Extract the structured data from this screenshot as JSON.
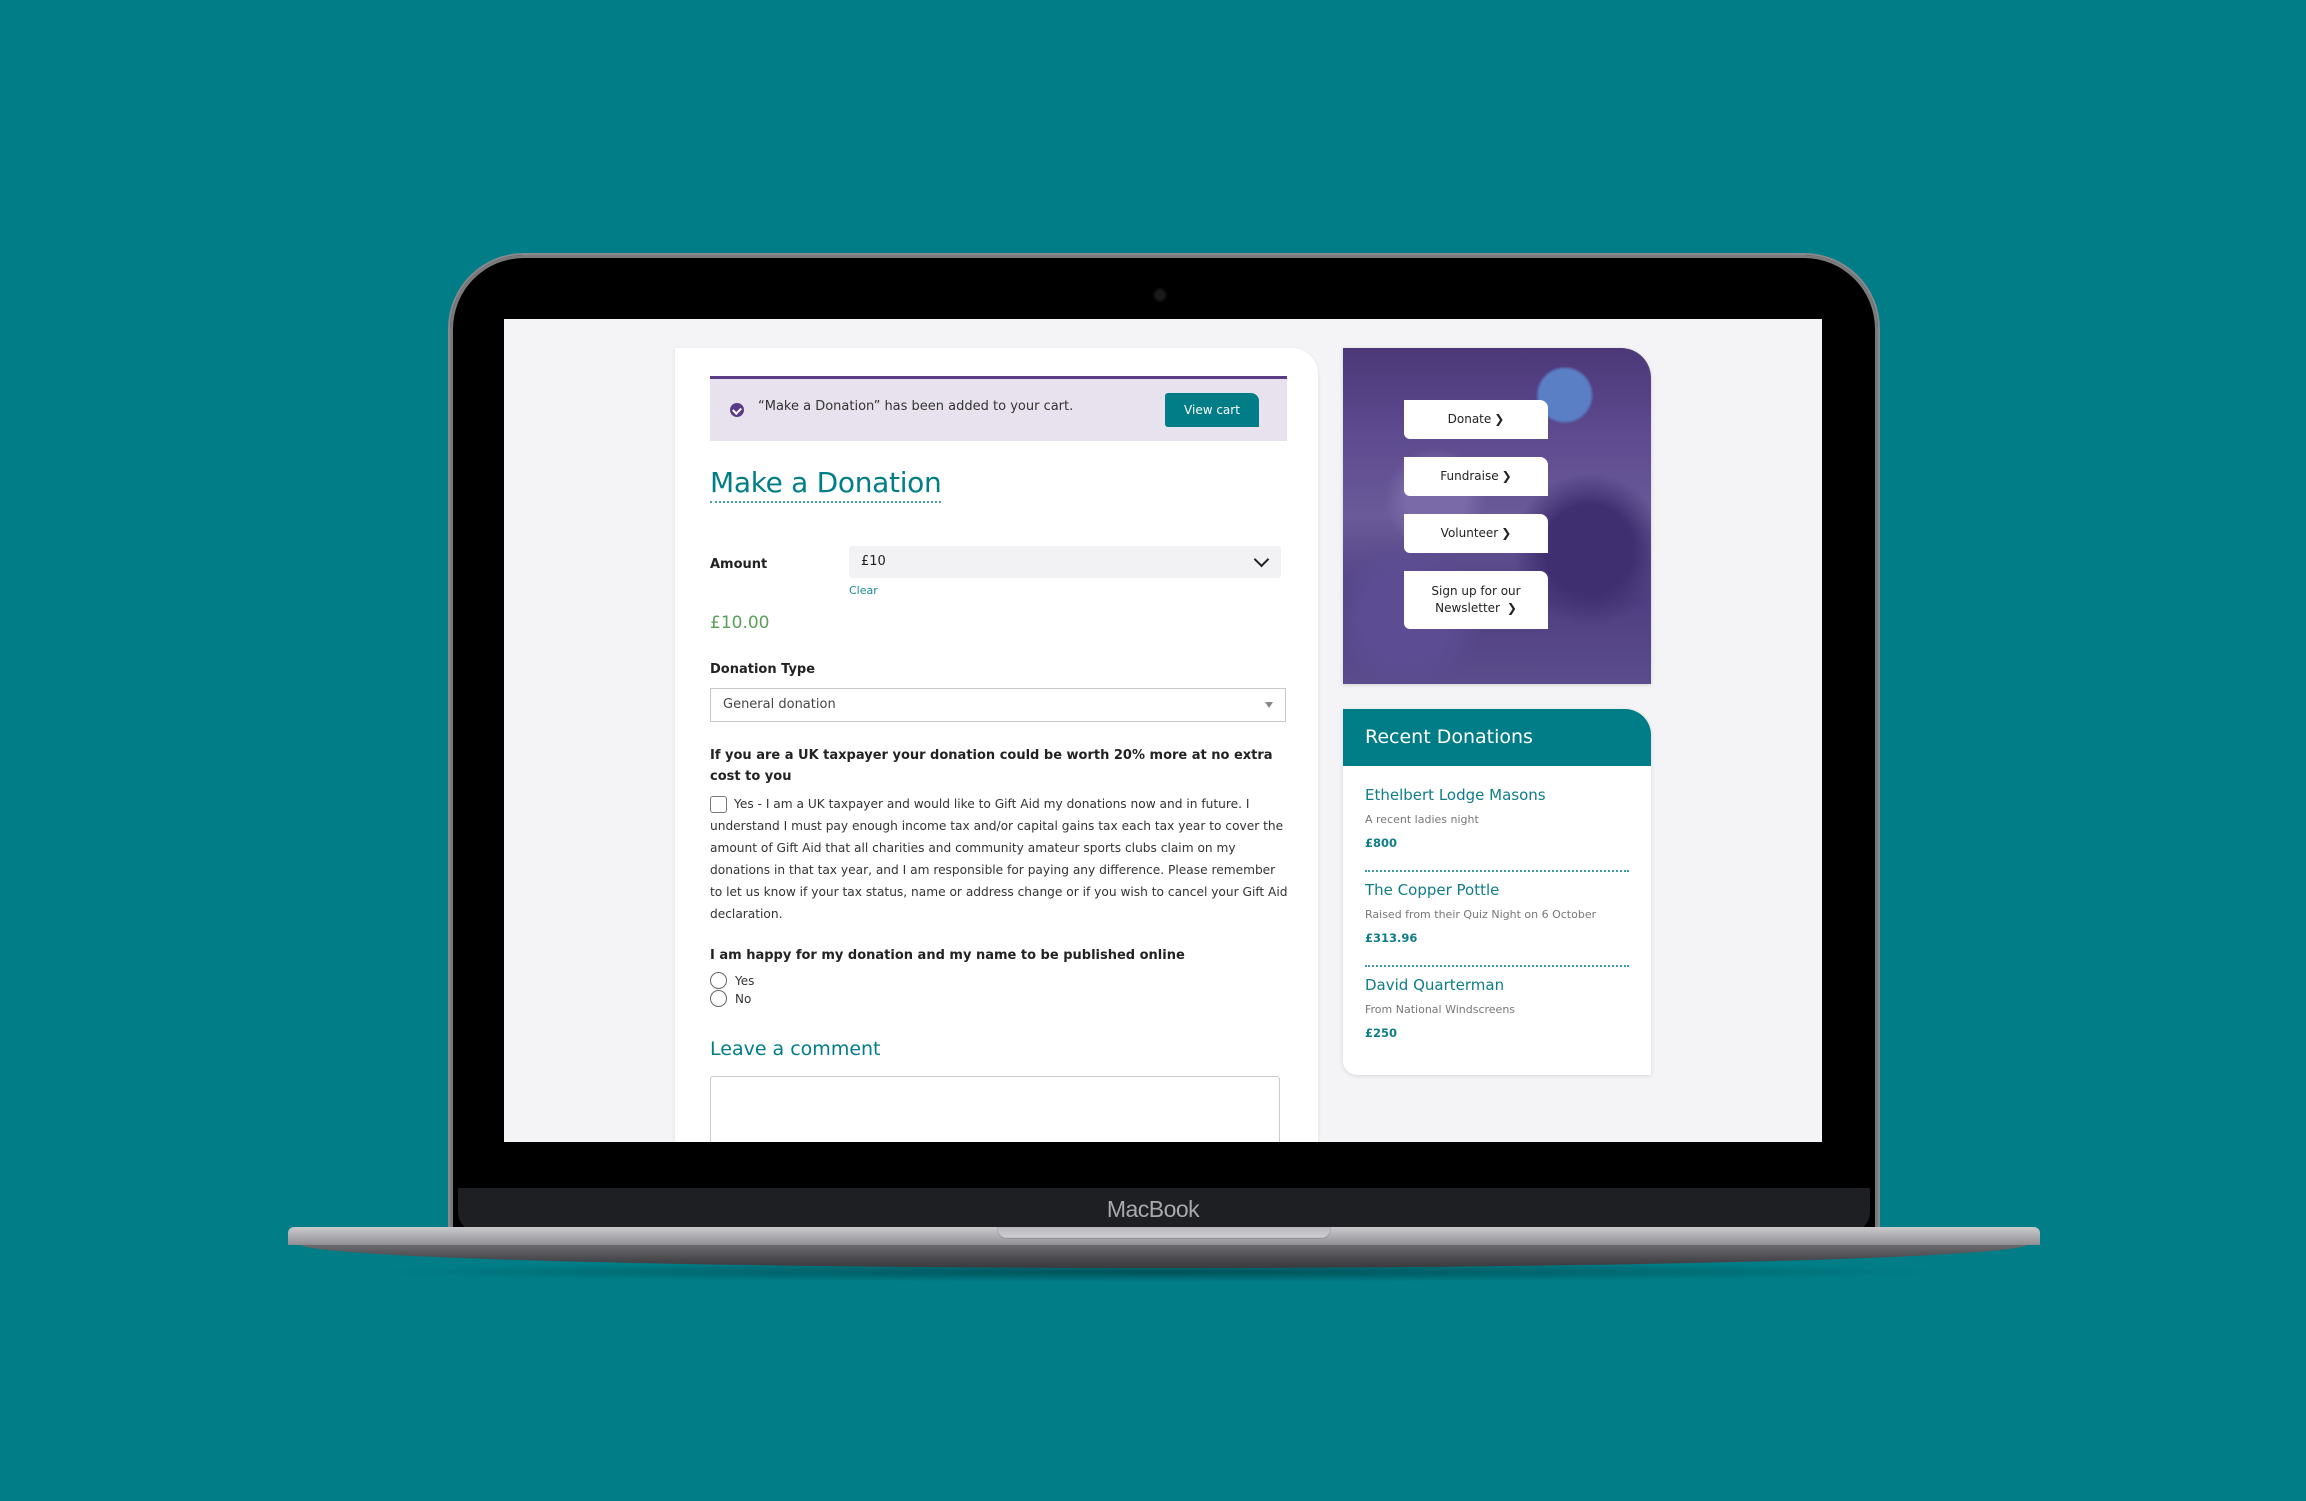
{
  "device": {
    "label": "MacBook"
  },
  "notice": {
    "message": "“Make a Donation” has been added to your cart.",
    "button": "View cart"
  },
  "form": {
    "title": "Make a Donation",
    "amount_label": "Amount",
    "amount_value": "£10",
    "clear_label": "Clear",
    "price": "£10.00",
    "type_label": "Donation Type",
    "type_value": "General donation",
    "giftaid_heading": "If you are a UK taxpayer your donation could be worth 20% more at no extra cost to you",
    "giftaid_text": "Yes - I am a UK taxpayer and would like to Gift Aid my donations now and in future. I understand I must pay enough income tax and/or capital gains tax each tax year to cover the amount of Gift Aid that all charities and community amateur sports clubs claim on my donations in that tax year, and I am responsible for paying any difference. Please remember to let us know if your tax status, name or address change or if you wish to cancel your Gift Aid declaration.",
    "giftaid_checked": false,
    "publish_heading": "I am happy for my donation and my name to be published online",
    "publish_options": [
      "Yes",
      "No"
    ],
    "comment_heading": "Leave a comment",
    "comment_value": ""
  },
  "sidebar": {
    "promo_buttons": [
      {
        "label": "Donate",
        "arrow": "❯"
      },
      {
        "label": "Fundraise",
        "arrow": "❯"
      },
      {
        "label": "Volunteer",
        "arrow": "❯"
      },
      {
        "label": "Sign up for our Newsletter",
        "arrow": "❯"
      }
    ],
    "recent_title": "Recent Donations",
    "donations": [
      {
        "name": "Ethelbert Lodge Masons",
        "desc": "A recent ladies night",
        "amount": "£800"
      },
      {
        "name": "The Copper Pottle",
        "desc": "Raised from their Quiz Night on 6 October",
        "amount": "£313.96"
      },
      {
        "name": "David Quarterman",
        "desc": "From National Windscreens",
        "amount": "£250"
      }
    ]
  },
  "colors": {
    "background": "#007d87",
    "accent_teal": "#007d87",
    "accent_purple": "#5b3a86",
    "price_green": "#5aa05a"
  }
}
